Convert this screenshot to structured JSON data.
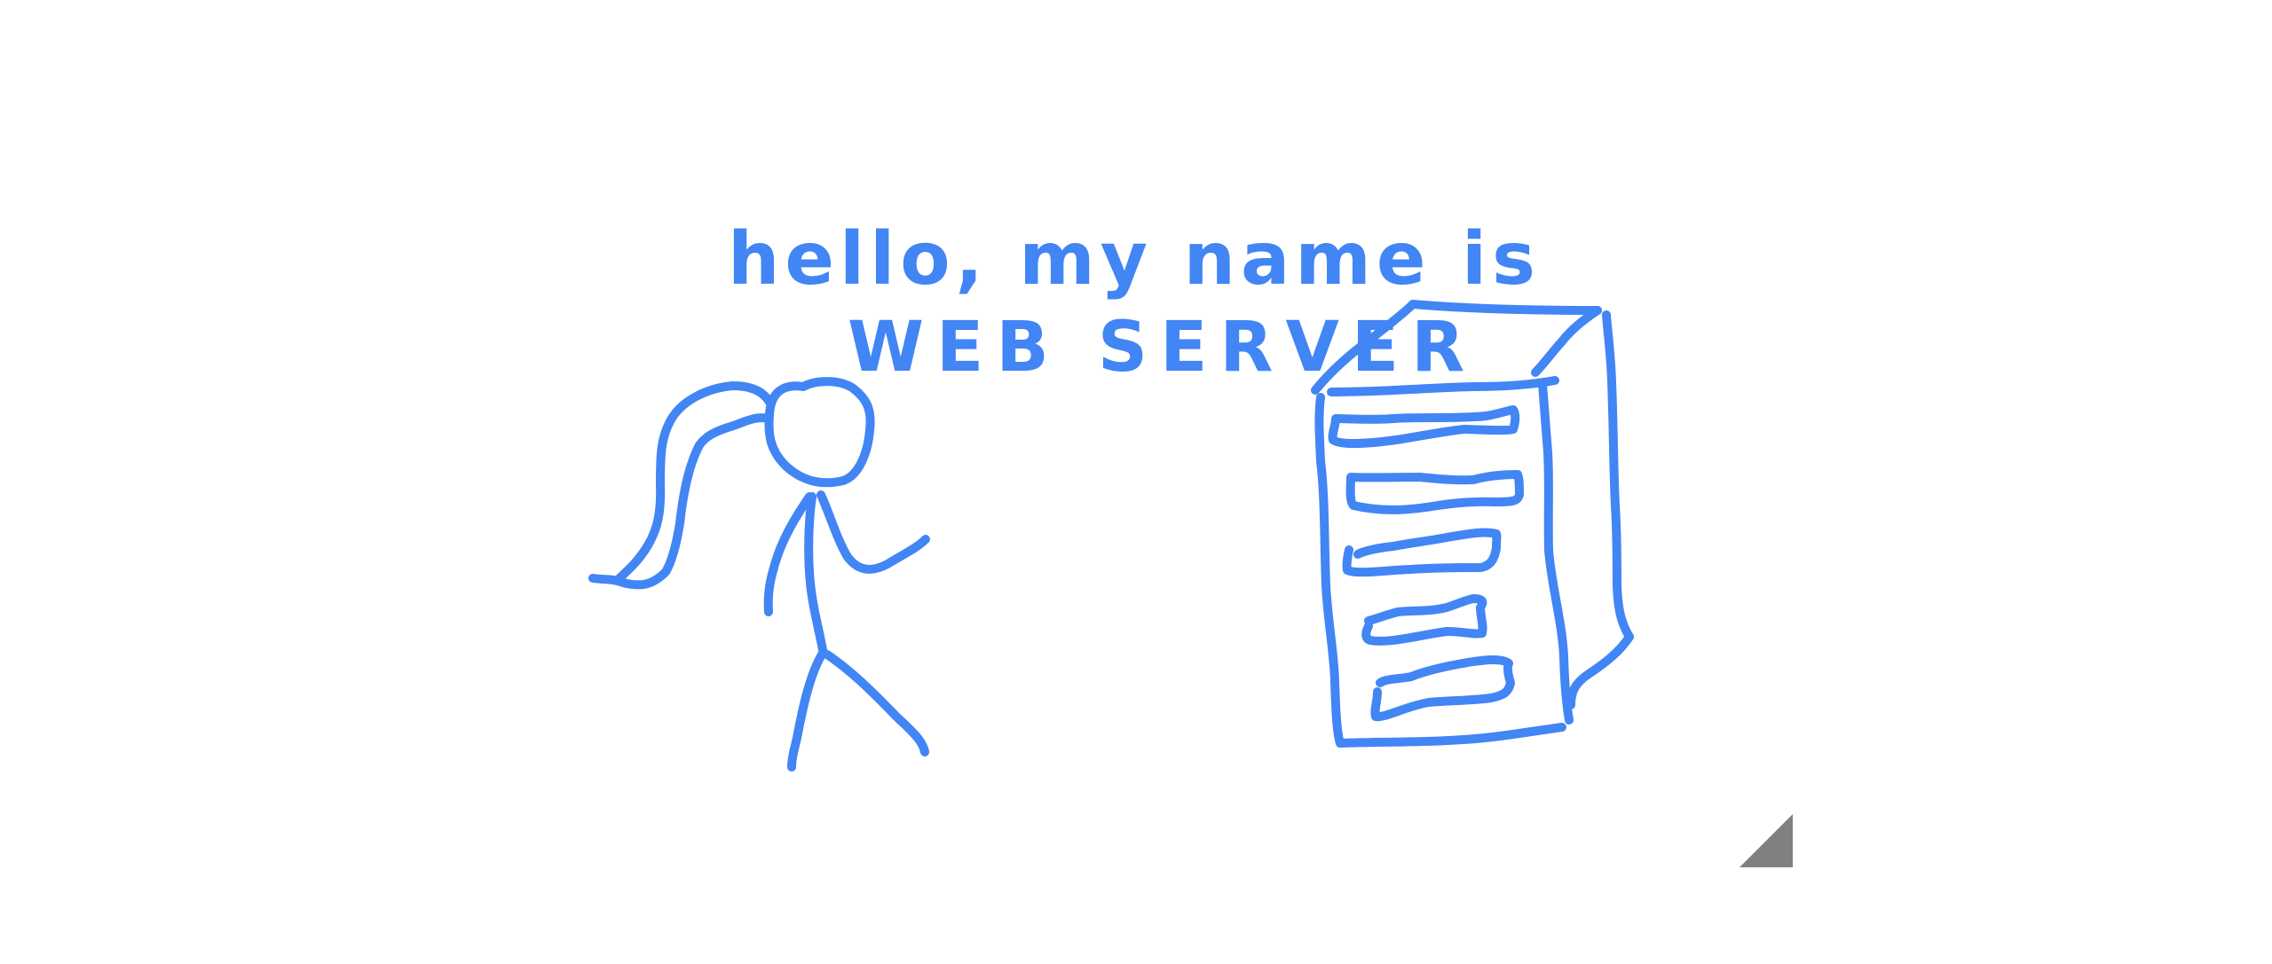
{
  "caption": {
    "line1": "hello, my name is",
    "line2": "WEB SERVER"
  },
  "colors": {
    "ink": "#4285f4",
    "background": "#ffffff",
    "corner_marker": "#808080"
  },
  "icons": [
    "stick-figure-icon",
    "server-tower-icon",
    "page-corner-icon"
  ]
}
